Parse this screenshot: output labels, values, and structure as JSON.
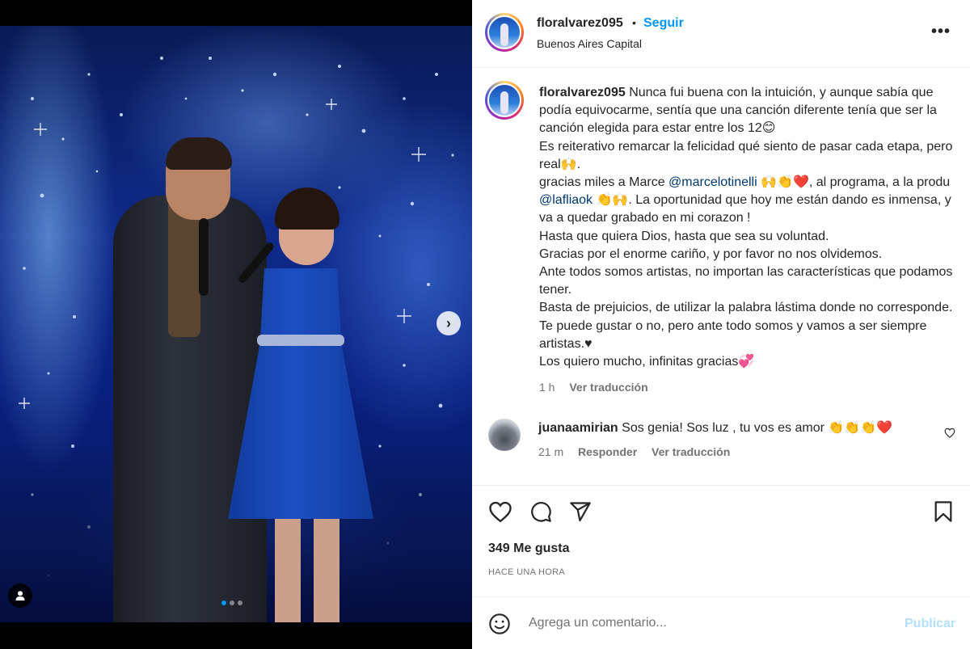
{
  "post": {
    "username": "floralvarez095",
    "separator": "•",
    "follow_label": "Seguir",
    "location": "Buenos Aires Capital",
    "more_label": "•••"
  },
  "caption": {
    "username": "floralvarez095",
    "lines": [
      "Nunca fui buena con la intuición, y aunque sabía que podía equivocarme, sentía que una canción diferente tenía que ser la canción elegida para estar entre los 12😊",
      "Es reiterativo remarcar la felicidad qué siento de pasar cada etapa, pero real🙌.",
      "gracias miles a Marce ",
      "@marcelotinelli",
      " 🙌👏❤️, al programa, a la produ ",
      "@lafliaok",
      " 👏🙌. La oportunidad que hoy me están dando es inmensa, y va a quedar grabado en mi corazon !",
      "Hasta que quiera Dios, hasta que sea su voluntad.",
      "Gracias por el enorme cariño, y por favor no nos olvidemos.",
      "Ante todos somos artistas, no importan las características que podamos tener.",
      "Basta de prejuicios, de utilizar la palabra lástima donde no corresponde. Te puede gustar o no, pero ante todo somos y vamos a ser siempre artistas.♥",
      "Los quiero mucho, infinitas gracias💞"
    ],
    "time": "1 h",
    "translate_label": "Ver traducción"
  },
  "comment": {
    "username": "juanaamirian",
    "text": "Sos genia! Sos luz , tu vos es amor 👏👏👏❤️",
    "time": "21 m",
    "reply_label": "Responder",
    "translate_label": "Ver traducción"
  },
  "footer": {
    "likes": "349 Me gusta",
    "time_ago": "HACE UNA HORA",
    "comment_placeholder": "Agrega un comentario...",
    "publish_label": "Publicar"
  },
  "carousel": {
    "next_symbol": "›",
    "total": 3,
    "current": 1
  },
  "colors": {
    "accent": "#0095f6",
    "mention": "#00376b",
    "publish_disabled": "#b2dffc"
  }
}
